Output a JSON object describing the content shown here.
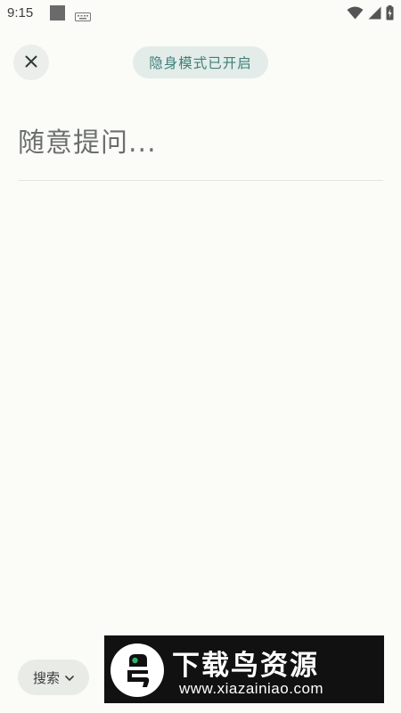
{
  "status_bar": {
    "time": "9:15",
    "icons": [
      "square-notification-icon",
      "keyboard-icon",
      "wifi-icon",
      "signal-icon",
      "battery-icon"
    ]
  },
  "header": {
    "close_icon": "close-icon",
    "incognito_label": "隐身模式已开启"
  },
  "prompt": {
    "placeholder": "随意提问...",
    "value": ""
  },
  "footer": {
    "search_label": "搜索",
    "search_icon": "chevron-down-icon"
  },
  "watermark": {
    "brand": "下载鸟资源",
    "url": "www.xiazainiao.com"
  },
  "colors": {
    "background": "#fbfcf8",
    "badge_bg": "#e3ece8",
    "badge_text": "#3f7f7a",
    "chip_bg": "#e9ebe7",
    "watermark_bg": "#111111"
  }
}
